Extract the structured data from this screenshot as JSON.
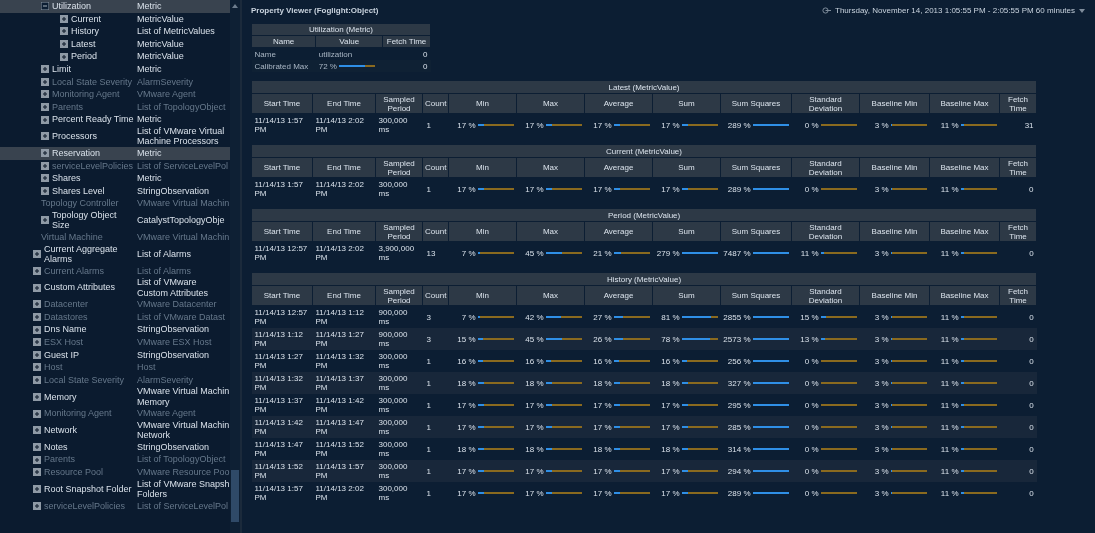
{
  "tree": {
    "partial_branch": [
      {
        "name": "Utilization",
        "type": "Metric",
        "kind": "branch",
        "expanded": true,
        "disabled": false,
        "selected": true,
        "children": [
          {
            "name": "Current",
            "type": "MetricValue",
            "kind": "branch",
            "expanded": false,
            "disabled": false,
            "selected": false
          },
          {
            "name": "History",
            "type": "List of MetricValues",
            "kind": "branch",
            "expanded": false,
            "disabled": false,
            "selected": false
          },
          {
            "name": "Latest",
            "type": "MetricValue",
            "kind": "branch",
            "expanded": false,
            "disabled": false,
            "selected": false
          },
          {
            "name": "Period",
            "type": "MetricValue",
            "kind": "branch",
            "expanded": false,
            "disabled": false,
            "selected": false
          }
        ]
      },
      {
        "name": "Limit",
        "type": "Metric",
        "kind": "branch",
        "expanded": false,
        "disabled": false,
        "selected": false
      },
      {
        "name": "Local State Severity",
        "type": "AlarmSeverity",
        "kind": "branch",
        "expanded": false,
        "disabled": true,
        "selected": false
      },
      {
        "name": "Monitoring Agent",
        "type": "VMware Agent",
        "kind": "branch",
        "expanded": false,
        "disabled": true,
        "selected": false
      },
      {
        "name": "Parents",
        "type": "List of TopologyObject",
        "kind": "branch",
        "expanded": false,
        "disabled": true,
        "selected": false
      },
      {
        "name": "Percent Ready Time",
        "type": "Metric",
        "kind": "branch",
        "expanded": false,
        "disabled": false,
        "selected": false
      },
      {
        "name": "Processors",
        "type": "List of VMware Virtual Machine Processors",
        "kind": "branch",
        "expanded": false,
        "disabled": false,
        "selected": false
      },
      {
        "name": "Reservation",
        "type": "Metric",
        "kind": "branch",
        "expanded": false,
        "disabled": false,
        "selected": true
      },
      {
        "name": "serviceLevelPolicies",
        "type": "List of ServiceLevelPol",
        "kind": "branch",
        "expanded": false,
        "disabled": true,
        "selected": false
      },
      {
        "name": "Shares",
        "type": "Metric",
        "kind": "branch",
        "expanded": false,
        "disabled": false,
        "selected": false
      },
      {
        "name": "Shares Level",
        "type": "StringObservation",
        "kind": "branch",
        "expanded": false,
        "disabled": false,
        "selected": false
      },
      {
        "name": "Topology Controller",
        "type": "VMware Virtual Machin",
        "kind": "leaf",
        "disabled": true,
        "selected": false
      },
      {
        "name": "Topology Object Size",
        "type": "CatalystTopologyObje",
        "kind": "branch",
        "expanded": false,
        "disabled": false,
        "selected": false
      },
      {
        "name": "Virtual Machine",
        "type": "VMware Virtual Machin",
        "kind": "leaf",
        "disabled": true,
        "selected": false
      }
    ],
    "items": [
      {
        "name": "Current Aggregate Alarms",
        "type": "List of Alarms",
        "kind": "branch",
        "expanded": false,
        "disabled": false,
        "selected": false
      },
      {
        "name": "Current Alarms",
        "type": "List of Alarms",
        "kind": "branch",
        "expanded": false,
        "disabled": true,
        "selected": false
      },
      {
        "name": "Custom Attributes",
        "type": "List of VMware Custom Attributes",
        "kind": "branch",
        "expanded": false,
        "disabled": false,
        "selected": false
      },
      {
        "name": "Datacenter",
        "type": "VMware Datacenter",
        "kind": "branch",
        "expanded": false,
        "disabled": true,
        "selected": false
      },
      {
        "name": "Datastores",
        "type": "List of VMware Datast",
        "kind": "branch",
        "expanded": false,
        "disabled": true,
        "selected": false
      },
      {
        "name": "Dns Name",
        "type": "StringObservation",
        "kind": "branch",
        "expanded": false,
        "disabled": false,
        "selected": false
      },
      {
        "name": "ESX Host",
        "type": "VMware ESX Host",
        "kind": "branch",
        "expanded": false,
        "disabled": true,
        "selected": false
      },
      {
        "name": "Guest IP",
        "type": "StringObservation",
        "kind": "branch",
        "expanded": false,
        "disabled": false,
        "selected": false
      },
      {
        "name": "Host",
        "type": "Host",
        "kind": "branch",
        "expanded": false,
        "disabled": true,
        "selected": false
      },
      {
        "name": "Local State Severity",
        "type": "AlarmSeverity",
        "kind": "branch",
        "expanded": false,
        "disabled": true,
        "selected": false
      },
      {
        "name": "Memory",
        "type": "VMware Virtual Machin Memory",
        "kind": "branch",
        "expanded": false,
        "disabled": false,
        "selected": false
      },
      {
        "name": "Monitoring Agent",
        "type": "VMware Agent",
        "kind": "branch",
        "expanded": false,
        "disabled": true,
        "selected": false
      },
      {
        "name": "Network",
        "type": "VMware Virtual Machin Network",
        "kind": "branch",
        "expanded": false,
        "disabled": false,
        "selected": false
      },
      {
        "name": "Notes",
        "type": "StringObservation",
        "kind": "branch",
        "expanded": false,
        "disabled": false,
        "selected": false
      },
      {
        "name": "Parents",
        "type": "List of TopologyObject",
        "kind": "branch",
        "expanded": false,
        "disabled": true,
        "selected": false
      },
      {
        "name": "Resource Pool",
        "type": "VMware Resource Poo",
        "kind": "branch",
        "expanded": false,
        "disabled": true,
        "selected": false
      },
      {
        "name": "Root Snapshot Folder",
        "type": "List of VMware Snapsh Folders",
        "kind": "branch",
        "expanded": false,
        "disabled": false,
        "selected": false
      },
      {
        "name": "serviceLevelPolicies",
        "type": "List of ServiceLevelPol",
        "kind": "branch",
        "expanded": false,
        "disabled": true,
        "selected": false
      }
    ]
  },
  "viewer": {
    "title": "Property Viewer (Foglight:Object)",
    "time_range": "Thursday, November 14, 2013 1:05:55 PM - 2:05:55 PM 60 minutes",
    "summary": {
      "title": "Utilization (Metric)",
      "columns": [
        "Name",
        "Value",
        "Fetch Time"
      ],
      "rows": [
        {
          "name": "Name",
          "kind": "text",
          "value": "utilization",
          "fetch": "0"
        },
        {
          "name": "Calibrated Max",
          "kind": "meter",
          "value": "72 %",
          "level": 0.72,
          "fetch": "0"
        }
      ]
    },
    "tables": [
      {
        "title": "Latest (MetricValue)",
        "columns": [
          "Start Time",
          "End Time",
          "Sampled Period",
          "Count",
          "Min",
          "Max",
          "Average",
          "Sum",
          "Sum Squares",
          "Standard Deviation",
          "Baseline Min",
          "Baseline Max",
          "Fetch Time"
        ],
        "rows": [
          {
            "cells": [
              "11/14/13 1:57 PM",
              "11/14/13 2:02 PM",
              "300,000 ms",
              "1"
            ],
            "metrics": [
              {
                "text": "17 %",
                "level": 0.17
              },
              {
                "text": "17 %",
                "level": 0.17
              },
              {
                "text": "17 %",
                "level": 0.17
              },
              {
                "text": "17 %",
                "level": 0.17
              },
              {
                "text": "289 %",
                "level": 1
              },
              {
                "text": "0 %",
                "level": 0
              },
              {
                "text": "3 %",
                "level": 0.03
              },
              {
                "text": "11 %",
                "level": 0.11
              }
            ],
            "fetch": "31"
          }
        ]
      },
      {
        "title": "Current (MetricValue)",
        "columns": [
          "Start Time",
          "End Time",
          "Sampled Period",
          "Count",
          "Min",
          "Max",
          "Average",
          "Sum",
          "Sum Squares",
          "Standard Deviation",
          "Baseline Min",
          "Baseline Max",
          "Fetch Time"
        ],
        "rows": [
          {
            "cells": [
              "11/14/13 1:57 PM",
              "11/14/13 2:02 PM",
              "300,000 ms",
              "1"
            ],
            "metrics": [
              {
                "text": "17 %",
                "level": 0.17
              },
              {
                "text": "17 %",
                "level": 0.17
              },
              {
                "text": "17 %",
                "level": 0.17
              },
              {
                "text": "17 %",
                "level": 0.17
              },
              {
                "text": "289 %",
                "level": 1
              },
              {
                "text": "0 %",
                "level": 0
              },
              {
                "text": "3 %",
                "level": 0.03
              },
              {
                "text": "11 %",
                "level": 0.11
              }
            ],
            "fetch": "0"
          }
        ]
      },
      {
        "title": "Period (MetricValue)",
        "columns": [
          "Start Time",
          "End Time",
          "Sampled Period",
          "Count",
          "Min",
          "Max",
          "Average",
          "Sum",
          "Sum Squares",
          "Standard Deviation",
          "Baseline Min",
          "Baseline Max",
          "Fetch Time"
        ],
        "rows": [
          {
            "cells": [
              "11/14/13 12:57 PM",
              "11/14/13 2:02 PM",
              "3,900,000 ms",
              "13"
            ],
            "metrics": [
              {
                "text": "7 %",
                "level": 0.07
              },
              {
                "text": "45 %",
                "level": 0.45
              },
              {
                "text": "21 %",
                "level": 0.21
              },
              {
                "text": "279 %",
                "level": 1
              },
              {
                "text": "7487 %",
                "level": 1
              },
              {
                "text": "11 %",
                "level": 0.11
              },
              {
                "text": "3 %",
                "level": 0.03
              },
              {
                "text": "11 %",
                "level": 0.11
              }
            ],
            "fetch": "0"
          }
        ]
      },
      {
        "title": "History (MetricValue)",
        "columns": [
          "Start Time",
          "End Time",
          "Sampled Period",
          "Count",
          "Min",
          "Max",
          "Average",
          "Sum",
          "Sum Squares",
          "Standard Deviation",
          "Baseline Min",
          "Baseline Max",
          "Fetch Time"
        ],
        "rows": [
          {
            "cells": [
              "11/14/13 12:57 PM",
              "11/14/13 1:12 PM",
              "900,000 ms",
              "3"
            ],
            "metrics": [
              {
                "text": "7 %",
                "level": 0.07
              },
              {
                "text": "42 %",
                "level": 0.42
              },
              {
                "text": "27 %",
                "level": 0.27
              },
              {
                "text": "81 %",
                "level": 0.81
              },
              {
                "text": "2855 %",
                "level": 1
              },
              {
                "text": "15 %",
                "level": 0.15
              },
              {
                "text": "3 %",
                "level": 0.03
              },
              {
                "text": "11 %",
                "level": 0.11
              }
            ],
            "fetch": "0"
          },
          {
            "cells": [
              "11/14/13 1:12 PM",
              "11/14/13 1:27 PM",
              "900,000 ms",
              "3"
            ],
            "metrics": [
              {
                "text": "15 %",
                "level": 0.15
              },
              {
                "text": "45 %",
                "level": 0.45
              },
              {
                "text": "26 %",
                "level": 0.26
              },
              {
                "text": "78 %",
                "level": 0.78
              },
              {
                "text": "2573 %",
                "level": 1
              },
              {
                "text": "13 %",
                "level": 0.13
              },
              {
                "text": "3 %",
                "level": 0.03
              },
              {
                "text": "11 %",
                "level": 0.11
              }
            ],
            "fetch": "0"
          },
          {
            "cells": [
              "11/14/13 1:27 PM",
              "11/14/13 1:32 PM",
              "300,000 ms",
              "1"
            ],
            "metrics": [
              {
                "text": "16 %",
                "level": 0.16
              },
              {
                "text": "16 %",
                "level": 0.16
              },
              {
                "text": "16 %",
                "level": 0.16
              },
              {
                "text": "16 %",
                "level": 0.16
              },
              {
                "text": "256 %",
                "level": 1
              },
              {
                "text": "0 %",
                "level": 0
              },
              {
                "text": "3 %",
                "level": 0.03
              },
              {
                "text": "11 %",
                "level": 0.11
              }
            ],
            "fetch": "0"
          },
          {
            "cells": [
              "11/14/13 1:32 PM",
              "11/14/13 1:37 PM",
              "300,000 ms",
              "1"
            ],
            "metrics": [
              {
                "text": "18 %",
                "level": 0.18
              },
              {
                "text": "18 %",
                "level": 0.18
              },
              {
                "text": "18 %",
                "level": 0.18
              },
              {
                "text": "18 %",
                "level": 0.18
              },
              {
                "text": "327 %",
                "level": 1
              },
              {
                "text": "0 %",
                "level": 0
              },
              {
                "text": "3 %",
                "level": 0.03
              },
              {
                "text": "11 %",
                "level": 0.11
              }
            ],
            "fetch": "0"
          },
          {
            "cells": [
              "11/14/13 1:37 PM",
              "11/14/13 1:42 PM",
              "300,000 ms",
              "1"
            ],
            "metrics": [
              {
                "text": "17 %",
                "level": 0.17
              },
              {
                "text": "17 %",
                "level": 0.17
              },
              {
                "text": "17 %",
                "level": 0.17
              },
              {
                "text": "17 %",
                "level": 0.17
              },
              {
                "text": "295 %",
                "level": 1
              },
              {
                "text": "0 %",
                "level": 0
              },
              {
                "text": "3 %",
                "level": 0.03
              },
              {
                "text": "11 %",
                "level": 0.11
              }
            ],
            "fetch": "0"
          },
          {
            "cells": [
              "11/14/13 1:42 PM",
              "11/14/13 1:47 PM",
              "300,000 ms",
              "1"
            ],
            "metrics": [
              {
                "text": "17 %",
                "level": 0.17
              },
              {
                "text": "17 %",
                "level": 0.17
              },
              {
                "text": "17 %",
                "level": 0.17
              },
              {
                "text": "17 %",
                "level": 0.17
              },
              {
                "text": "285 %",
                "level": 1
              },
              {
                "text": "0 %",
                "level": 0
              },
              {
                "text": "3 %",
                "level": 0.03
              },
              {
                "text": "11 %",
                "level": 0.11
              }
            ],
            "fetch": "0"
          },
          {
            "cells": [
              "11/14/13 1:47 PM",
              "11/14/13 1:52 PM",
              "300,000 ms",
              "1"
            ],
            "metrics": [
              {
                "text": "18 %",
                "level": 0.18
              },
              {
                "text": "18 %",
                "level": 0.18
              },
              {
                "text": "18 %",
                "level": 0.18
              },
              {
                "text": "18 %",
                "level": 0.18
              },
              {
                "text": "314 %",
                "level": 1
              },
              {
                "text": "0 %",
                "level": 0
              },
              {
                "text": "3 %",
                "level": 0.03
              },
              {
                "text": "11 %",
                "level": 0.11
              }
            ],
            "fetch": "0"
          },
          {
            "cells": [
              "11/14/13 1:52 PM",
              "11/14/13 1:57 PM",
              "300,000 ms",
              "1"
            ],
            "metrics": [
              {
                "text": "17 %",
                "level": 0.17
              },
              {
                "text": "17 %",
                "level": 0.17
              },
              {
                "text": "17 %",
                "level": 0.17
              },
              {
                "text": "17 %",
                "level": 0.17
              },
              {
                "text": "294 %",
                "level": 1
              },
              {
                "text": "0 %",
                "level": 0
              },
              {
                "text": "3 %",
                "level": 0.03
              },
              {
                "text": "11 %",
                "level": 0.11
              }
            ],
            "fetch": "0"
          },
          {
            "cells": [
              "11/14/13 1:57 PM",
              "11/14/13 2:02 PM",
              "300,000 ms",
              "1"
            ],
            "metrics": [
              {
                "text": "17 %",
                "level": 0.17
              },
              {
                "text": "17 %",
                "level": 0.17
              },
              {
                "text": "17 %",
                "level": 0.17
              },
              {
                "text": "17 %",
                "level": 0.17
              },
              {
                "text": "289 %",
                "level": 1
              },
              {
                "text": "0 %",
                "level": 0
              },
              {
                "text": "3 %",
                "level": 0.03
              },
              {
                "text": "11 %",
                "level": 0.11
              }
            ],
            "fetch": "0"
          }
        ]
      }
    ]
  }
}
